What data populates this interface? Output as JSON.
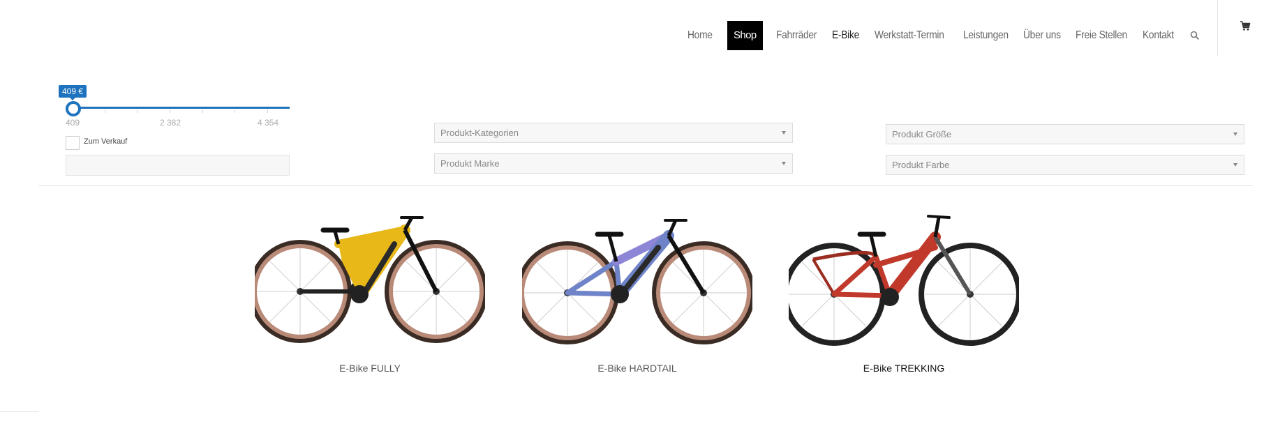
{
  "nav": {
    "items": [
      {
        "label": "Home"
      },
      {
        "label": "Shop"
      },
      {
        "label": "Fahrräder"
      },
      {
        "label": "E-Bike"
      },
      {
        "label": "Werkstatt-Termin"
      },
      {
        "label": "Leistungen"
      },
      {
        "label": "Über uns"
      },
      {
        "label": "Freie Stellen"
      },
      {
        "label": "Kontakt"
      }
    ],
    "search_icon": "search-icon",
    "cart_icon": "cart-icon"
  },
  "filters": {
    "price": {
      "badge": "409 €",
      "min_label": "409",
      "mid_label": "2 382",
      "max_label": "4 354",
      "current_value": 409
    },
    "sale_label": "Zum Verkauf",
    "selects": {
      "category": "Produkt-Kategorien",
      "brand": "Produkt Marke",
      "size": "Produkt Größe",
      "color": "Produkt Farbe"
    }
  },
  "products": [
    {
      "label": "E-Bike FULLY",
      "frame_color": "#e8b818"
    },
    {
      "label": "E-Bike HARDTAIL",
      "frame_color": "#7a8fd0"
    },
    {
      "label": "E-Bike TREKKING",
      "frame_color": "#c0392b"
    }
  ],
  "colors": {
    "accent": "#1e73be",
    "nav_active_bg": "#000000"
  }
}
